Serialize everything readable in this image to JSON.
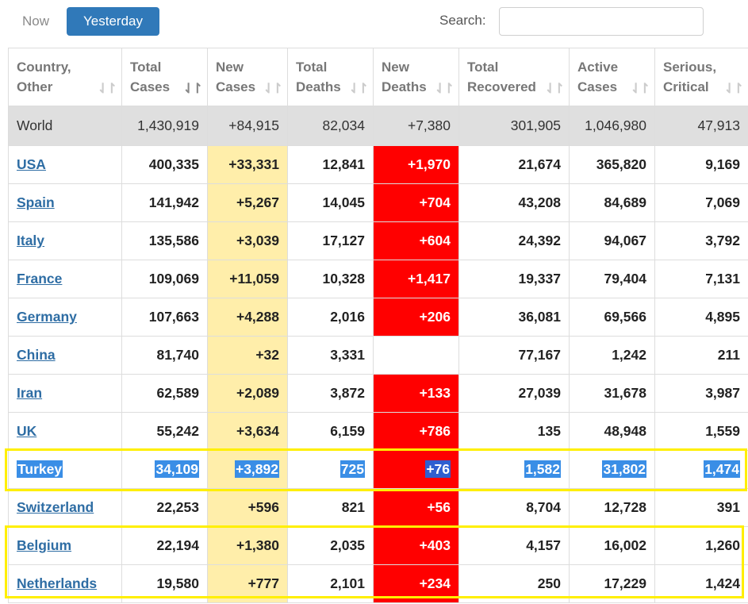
{
  "toolbar": {
    "now_label": "Now",
    "yesterday_label": "Yesterday",
    "search_label": "Search:",
    "search_value": ""
  },
  "table": {
    "headers": [
      {
        "line1": "Country,",
        "line2": "Other"
      },
      {
        "line1": "Total",
        "line2": "Cases"
      },
      {
        "line1": "New",
        "line2": "Cases"
      },
      {
        "line1": "Total",
        "line2": "Deaths"
      },
      {
        "line1": "New",
        "line2": "Deaths"
      },
      {
        "line1": "Total",
        "line2": "Recovered"
      },
      {
        "line1": "Active",
        "line2": "Cases"
      },
      {
        "line1": "Serious,",
        "line2": "Critical"
      }
    ],
    "sort_icon": "⇃↾",
    "world": {
      "country": "World",
      "total_cases": "1,430,919",
      "new_cases": "+84,915",
      "total_deaths": "82,034",
      "new_deaths": "+7,380",
      "total_recovered": "301,905",
      "active_cases": "1,046,980",
      "serious": "47,913"
    },
    "rows": [
      {
        "country": "USA",
        "total_cases": "400,335",
        "new_cases": "+33,331",
        "total_deaths": "12,841",
        "new_deaths": "+1,970",
        "total_recovered": "21,674",
        "active_cases": "365,820",
        "serious": "9,169"
      },
      {
        "country": "Spain",
        "total_cases": "141,942",
        "new_cases": "+5,267",
        "total_deaths": "14,045",
        "new_deaths": "+704",
        "total_recovered": "43,208",
        "active_cases": "84,689",
        "serious": "7,069"
      },
      {
        "country": "Italy",
        "total_cases": "135,586",
        "new_cases": "+3,039",
        "total_deaths": "17,127",
        "new_deaths": "+604",
        "total_recovered": "24,392",
        "active_cases": "94,067",
        "serious": "3,792"
      },
      {
        "country": "France",
        "total_cases": "109,069",
        "new_cases": "+11,059",
        "total_deaths": "10,328",
        "new_deaths": "+1,417",
        "total_recovered": "19,337",
        "active_cases": "79,404",
        "serious": "7,131"
      },
      {
        "country": "Germany",
        "total_cases": "107,663",
        "new_cases": "+4,288",
        "total_deaths": "2,016",
        "new_deaths": "+206",
        "total_recovered": "36,081",
        "active_cases": "69,566",
        "serious": "4,895"
      },
      {
        "country": "China",
        "total_cases": "81,740",
        "new_cases": "+32",
        "total_deaths": "3,331",
        "new_deaths": "",
        "total_recovered": "77,167",
        "active_cases": "1,242",
        "serious": "211"
      },
      {
        "country": "Iran",
        "total_cases": "62,589",
        "new_cases": "+2,089",
        "total_deaths": "3,872",
        "new_deaths": "+133",
        "total_recovered": "27,039",
        "active_cases": "31,678",
        "serious": "3,987"
      },
      {
        "country": "UK",
        "total_cases": "55,242",
        "new_cases": "+3,634",
        "total_deaths": "6,159",
        "new_deaths": "+786",
        "total_recovered": "135",
        "active_cases": "48,948",
        "serious": "1,559"
      },
      {
        "country": "Turkey",
        "total_cases": "34,109",
        "new_cases": "+3,892",
        "total_deaths": "725",
        "new_deaths": "+76",
        "total_recovered": "1,582",
        "active_cases": "31,802",
        "serious": "1,474"
      },
      {
        "country": "Switzerland",
        "total_cases": "22,253",
        "new_cases": "+596",
        "total_deaths": "821",
        "new_deaths": "+56",
        "total_recovered": "8,704",
        "active_cases": "12,728",
        "serious": "391"
      },
      {
        "country": "Belgium",
        "total_cases": "22,194",
        "new_cases": "+1,380",
        "total_deaths": "2,035",
        "new_deaths": "+403",
        "total_recovered": "4,157",
        "active_cases": "16,002",
        "serious": "1,260"
      },
      {
        "country": "Netherlands",
        "total_cases": "19,580",
        "new_cases": "+777",
        "total_deaths": "2,101",
        "new_deaths": "+234",
        "total_recovered": "250",
        "active_cases": "17,229",
        "serious": "1,424"
      }
    ]
  },
  "colors": {
    "accent": "#3079b9",
    "new_cases_bg": "#ffeeaa",
    "new_deaths_bg": "#ff0000",
    "selection": "#3a8ee6",
    "highlight_box": "#ffef00"
  }
}
